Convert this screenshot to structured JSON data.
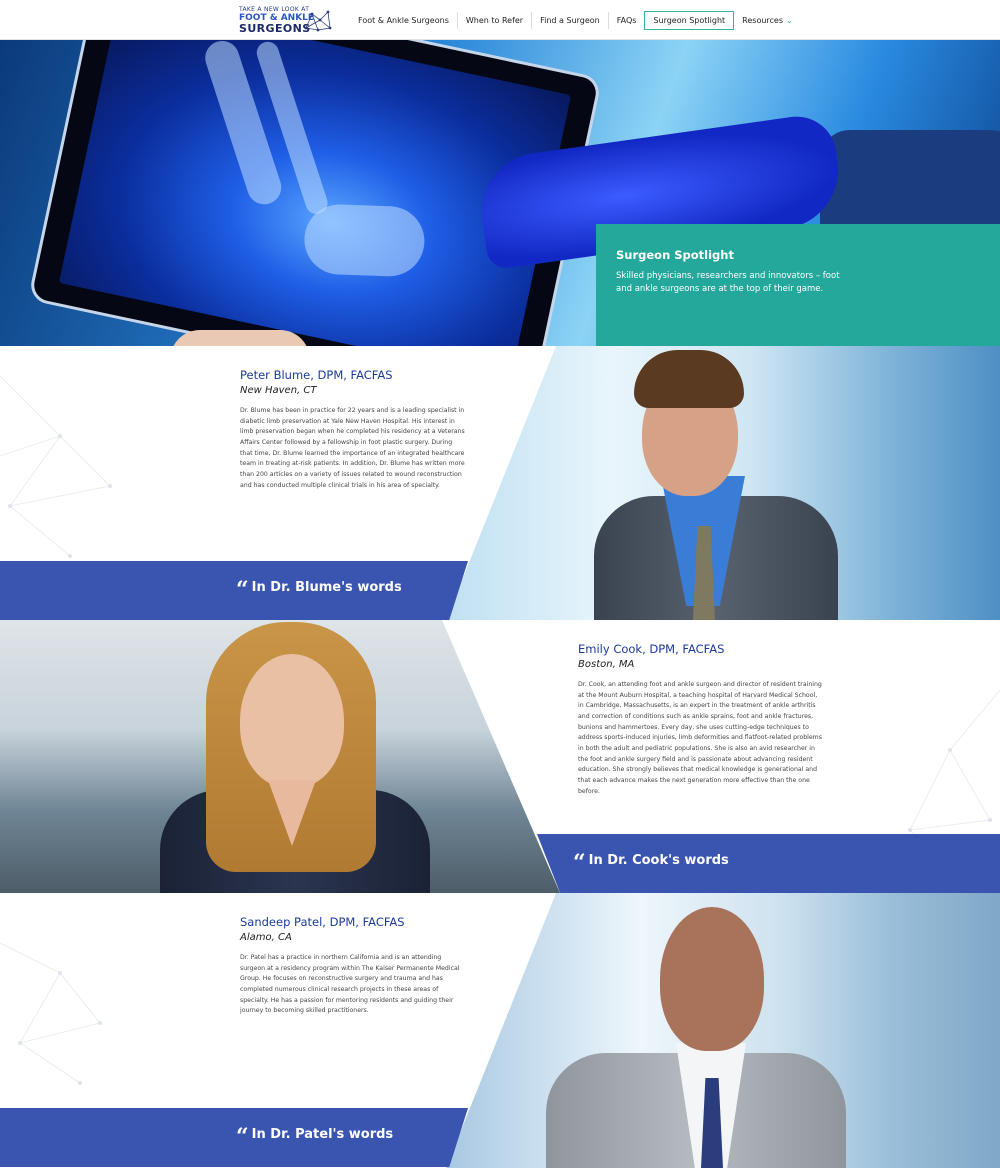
{
  "header": {
    "logo": {
      "line1": "TAKE A NEW LOOK AT",
      "line2": "FOOT & ANKLE",
      "line3": "SURGEONS"
    },
    "nav": [
      {
        "label": "Foot & Ankle Surgeons"
      },
      {
        "label": "When to Refer"
      },
      {
        "label": "Find a Surgeon"
      },
      {
        "label": "FAQs"
      },
      {
        "label": "Surgeon Spotlight",
        "active": true
      },
      {
        "label": "Resources",
        "has_dropdown": true
      }
    ]
  },
  "hero": {
    "title": "Surgeon Spotlight",
    "subtitle": "Skilled physicians, researchers and innovators – foot and ankle surgeons are at the top of their game."
  },
  "surgeons": [
    {
      "name": "Peter Blume, DPM, FACFAS",
      "location": "New Haven, CT",
      "bio": "Dr. Blume has been in practice for 22 years and is a leading specialist in diabetic limb preservation at Yale New Haven Hospital. His interest in limb preservation began when he completed his residency at a Veterans Affairs Center followed by a fellowship in foot plastic surgery. During that time, Dr. Blume learned the importance of an integrated healthcare team in treating at-risk patients. In addition, Dr. Blume has written more than 200 articles on a variety of issues related to wound reconstruction and has conducted multiple clinical trials in his area of specialty.",
      "quote_link": "In Dr. Blume's words"
    },
    {
      "name": "Emily Cook, DPM, FACFAS",
      "location": "Boston, MA",
      "bio": "Dr. Cook, an attending foot and ankle surgeon and director of resident training at the Mount Auburn Hospital, a teaching hospital of Harvard Medical School, in Cambridge, Massachusetts, is an expert in the treatment of ankle arthritis and correction of conditions such as ankle sprains, foot and ankle fractures, bunions and hammertoes. Every day, she uses cutting-edge techniques to address sports-induced injuries, limb deformities and flatfoot-related problems in both the adult and pediatric populations. She is also an avid researcher in the foot and ankle surgery field and is passionate about advancing resident education. She strongly believes that medical knowledge is generational and that each advance makes the next generation more effective than the one before.",
      "quote_link": "In Dr. Cook's words"
    },
    {
      "name": "Sandeep Patel, DPM, FACFAS",
      "location": "Alamo, CA",
      "bio": "Dr. Patel has a practice in northern California and is an attending surgeon at a residency program within The Kaiser Permanente Medical Group. He focuses on reconstructive surgery and trauma and has completed numerous clinical research projects in these areas of specialty. He has a passion for mentoring residents and guiding their journey to becoming skilled practitioners.",
      "quote_link": "In Dr. Patel's words"
    }
  ],
  "colors": {
    "teal": "#24a89c",
    "band_blue": "#3a55b0",
    "name_blue": "#1c3a9c"
  },
  "icons": [
    "logo-network-icon",
    "quote-icon",
    "chevron-down-icon"
  ]
}
